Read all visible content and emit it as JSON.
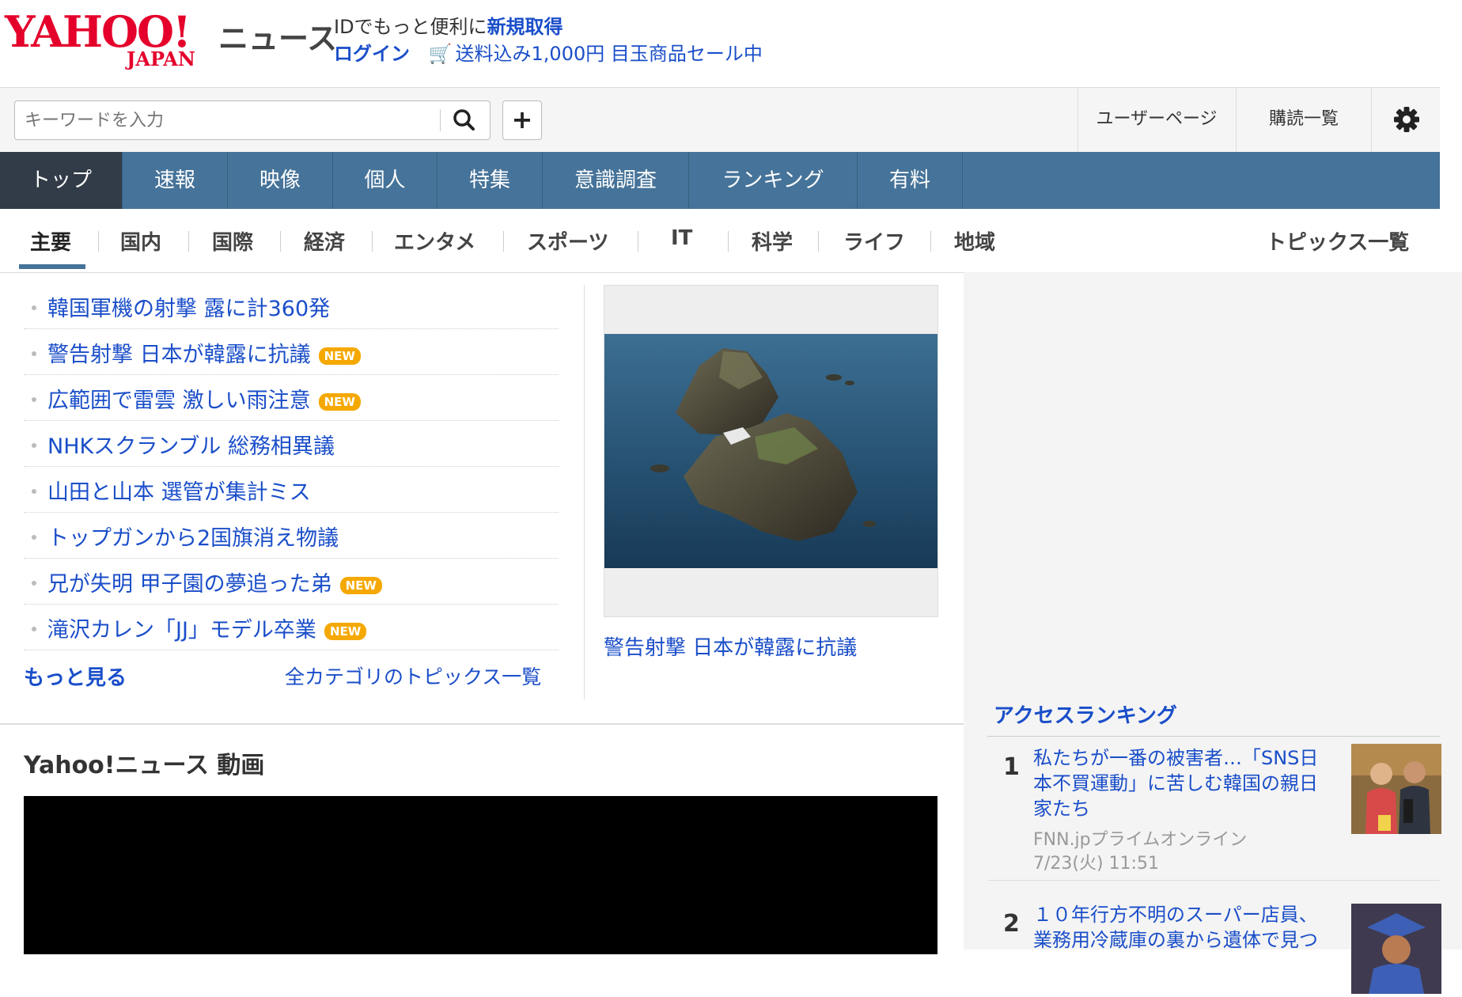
{
  "header": {
    "logo_text": "YAHOO!",
    "logo_sub": "JAPAN",
    "service_name": "ニュース",
    "promo_line1_prefix": "IDでもっと便利に",
    "promo_line1_link": "新規取得",
    "login": "ログイン",
    "cart_icon": "cart-icon",
    "promo_line2": "送料込み1,000円 目玉商品セール中"
  },
  "search": {
    "placeholder": "キーワードを入力",
    "add_label": "+",
    "user_page": "ユーザーページ",
    "subscribe": "購読一覧"
  },
  "nav": [
    "トップ",
    "速報",
    "映像",
    "個人",
    "特集",
    "意識調査",
    "ランキング",
    "有料"
  ],
  "subnav": [
    "主要",
    "国内",
    "国際",
    "経済",
    "エンタメ",
    "スポーツ",
    "IT",
    "科学",
    "ライフ",
    "地域"
  ],
  "subnav_all": "トピックス一覧",
  "topics": [
    {
      "title": "韓国軍機の射撃 露に計360発",
      "new": ""
    },
    {
      "title": "警告射撃 日本が韓露に抗議",
      "new": "NEW"
    },
    {
      "title": "広範囲で雷雲 激しい雨注意",
      "new": "NEW"
    },
    {
      "title": "NHKスクランブル 総務相異議",
      "new": ""
    },
    {
      "title": "山田と山本 選管が集計ミス",
      "new": ""
    },
    {
      "title": "トップガンから2国旗消え物議",
      "new": ""
    },
    {
      "title": "兄が失明 甲子園の夢追った弟",
      "new": "NEW"
    },
    {
      "title": "滝沢カレン「JJ」モデル卒業",
      "new": "NEW"
    }
  ],
  "more_label": "もっと見る",
  "all_categories": "全カテゴリのトピックス一覧",
  "pickup_caption": "警告射撃 日本が韓露に抗議",
  "ranking": {
    "title": "アクセスランキング",
    "items": [
      {
        "rank": "1",
        "title_lines": [
          "私たちが一番の被害者…「SNS日",
          "本不買運動」に苦しむ韓国の親日",
          "家たち"
        ],
        "source": "FNN.jpプライムオンライン",
        "time": "7/23(火) 11:51"
      },
      {
        "rank": "2",
        "title_lines": [
          "１０年行方不明のスーパー店員、",
          "業務用冷蔵庫の裏から遺体で見つ"
        ],
        "source": "",
        "time": ""
      }
    ]
  },
  "video": {
    "title": "Yahoo!ニュース 動画"
  },
  "colors": {
    "nav_bg": "#467399",
    "nav_active": "#323c48",
    "link": "#1a4ec9",
    "new_badge": "#f5a800",
    "logo_red": "#e4002b"
  }
}
